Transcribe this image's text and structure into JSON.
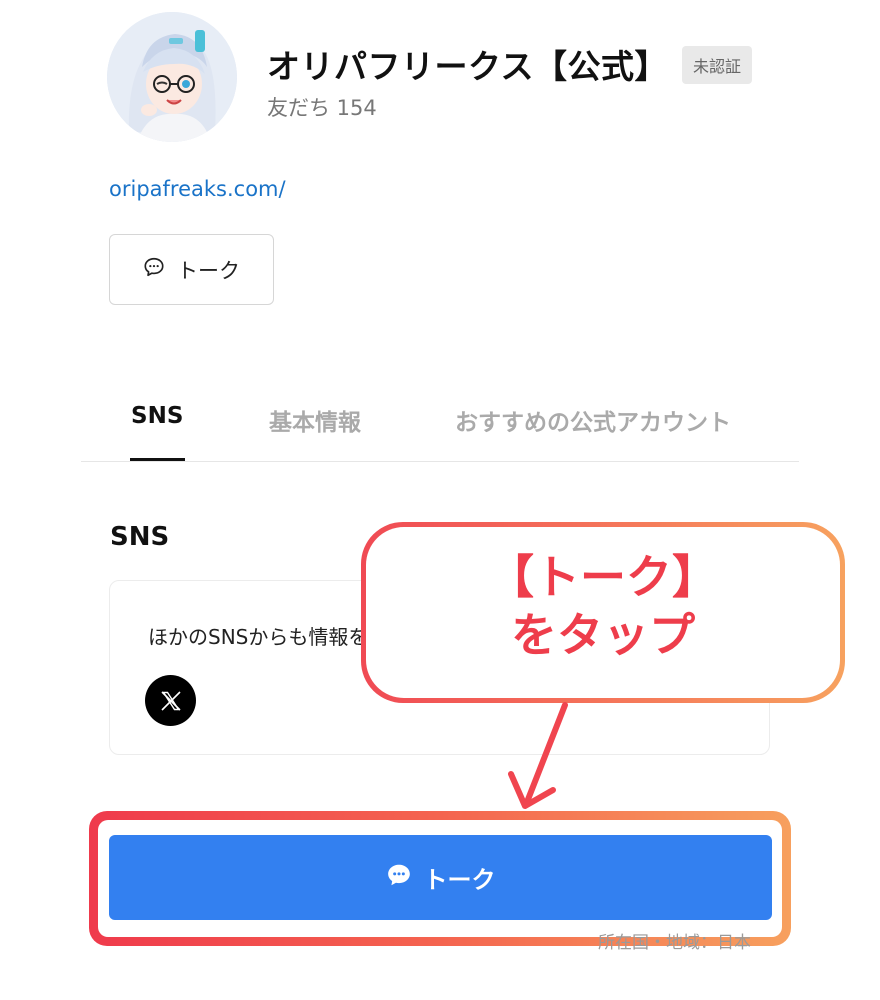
{
  "profile": {
    "name": "オリパフリークス【公式】",
    "badge": "未認証",
    "friends": "友だち 154",
    "website": "oripafreaks.com/"
  },
  "actions": {
    "talk_label": "トーク"
  },
  "tabs": [
    {
      "label": "SNS",
      "active": true
    },
    {
      "label": "基本情報",
      "active": false
    },
    {
      "label": "おすすめの公式アカウント",
      "active": false
    }
  ],
  "sns_section": {
    "title": "SNS",
    "card_text": "ほかのSNSからも情報を確認できます",
    "icon": "x-logo-icon"
  },
  "callout": {
    "line1": "【トーク】",
    "line2": "をタップ"
  },
  "footer": {
    "location": "所在国・地域：日本"
  },
  "colors": {
    "primary_button": "#3380f0",
    "link": "#1a73c8",
    "callout_text": "#ee3d4b",
    "highlight_start": "#ef3a4c",
    "highlight_end": "#f7a05e"
  }
}
